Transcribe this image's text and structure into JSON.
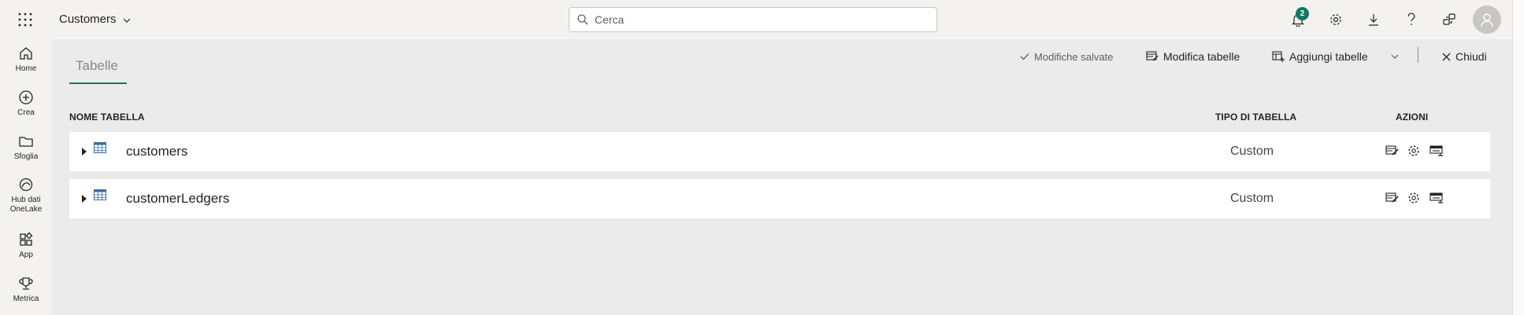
{
  "header": {
    "app_title": "Customers",
    "search_placeholder": "Cerca",
    "notification_count": "2"
  },
  "rail": [
    {
      "label": "Home",
      "icon": "home-icon"
    },
    {
      "label": "Crea",
      "icon": "add-circle-icon"
    },
    {
      "label": "Sfoglia",
      "icon": "folder-icon"
    },
    {
      "label": "Hub dati OneLake",
      "icon": "onelake-icon"
    },
    {
      "label": "App",
      "icon": "apps-icon"
    },
    {
      "label": "Metrica",
      "icon": "trophy-icon"
    }
  ],
  "tabs": {
    "active": "Tabelle"
  },
  "commands": {
    "saved": "Modifiche salvate",
    "edit_tables": "Modifica tabelle",
    "add_tables": "Aggiungi tabelle",
    "close": "Chiudi"
  },
  "table": {
    "headers": {
      "name": "NOME TABELLA",
      "type": "TIPO DI TABELLA",
      "actions": "AZIONI"
    },
    "rows": [
      {
        "name": "customers",
        "type": "Custom"
      },
      {
        "name": "customerLedgers",
        "type": "Custom"
      }
    ]
  },
  "colors": {
    "accent": "#117865"
  }
}
